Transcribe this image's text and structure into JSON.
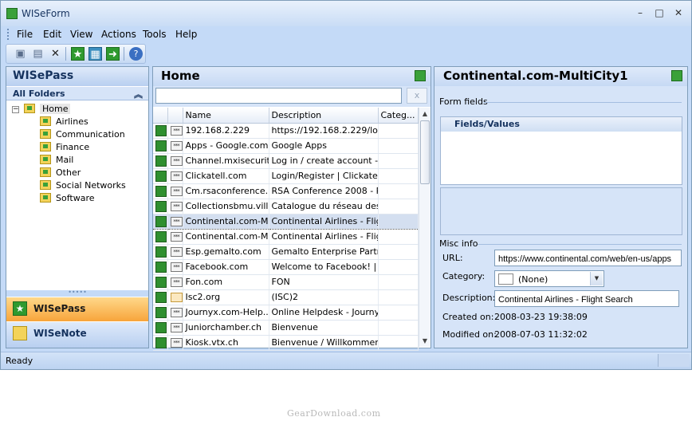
{
  "app": {
    "title": "WISeForm"
  },
  "menu": [
    "File",
    "Edit",
    "View",
    "Actions",
    "Tools",
    "Help"
  ],
  "toolbar": [
    {
      "icon": "save-icon",
      "label": "Save"
    },
    {
      "icon": "print-icon",
      "label": "Print"
    },
    {
      "icon": "delete-icon",
      "label": "Delete"
    },
    {
      "icon": "new-item-icon",
      "label": "New"
    },
    {
      "icon": "folder-icon",
      "label": "Folder"
    },
    {
      "icon": "go-icon",
      "label": "Go"
    },
    {
      "icon": "help-icon",
      "label": "Help"
    }
  ],
  "left": {
    "title": "WISePass",
    "section": "All Folders",
    "root": "Home",
    "folders": [
      "Airlines",
      "Communication",
      "Finance",
      "Mail",
      "Other",
      "Social Networks",
      "Software"
    ],
    "tabs": [
      {
        "label": "WISePass",
        "active": true
      },
      {
        "label": "WISeNote",
        "active": false
      }
    ]
  },
  "middle": {
    "title": "Home",
    "search": {
      "value": "",
      "clear_label": "x"
    },
    "columns": [
      "Name",
      "Description",
      "Categ..."
    ],
    "rows": [
      {
        "name": "192.168.2.229",
        "description": "https://192.168.2.229/lo...",
        "category": "",
        "cert": false,
        "selected": false
      },
      {
        "name": "Apps - Google.com",
        "description": "Google Apps",
        "category": "",
        "cert": false,
        "selected": false
      },
      {
        "name": "Channel.mxisecurit...",
        "description": "Log in / create account - ...",
        "category": "",
        "cert": false,
        "selected": false
      },
      {
        "name": "Clickatell.com",
        "description": "Login/Register | Clickatell",
        "category": "",
        "cert": false,
        "selected": false
      },
      {
        "name": "Cm.rsaconference....",
        "description": "RSA Conference 2008 - P...",
        "category": "",
        "cert": false,
        "selected": false
      },
      {
        "name": "Collectionsbmu.vill...",
        "description": "Catalogue du réseau des...",
        "category": "",
        "cert": false,
        "selected": false
      },
      {
        "name": "Continental.com-M...",
        "description": "Continental Airlines - Flig...",
        "category": "",
        "cert": false,
        "selected": true
      },
      {
        "name": "Continental.com-M...",
        "description": "Continental Airlines - Flig...",
        "category": "",
        "cert": false,
        "selected": false
      },
      {
        "name": "Esp.gemalto.com",
        "description": "Gemalto Enterprise Partn...",
        "category": "",
        "cert": false,
        "selected": false
      },
      {
        "name": "Facebook.com",
        "description": "Welcome to Facebook! | ...",
        "category": "",
        "cert": false,
        "selected": false
      },
      {
        "name": "Fon.com",
        "description": "FON",
        "category": "",
        "cert": false,
        "selected": false
      },
      {
        "name": "Isc2.org",
        "description": "(ISC)2",
        "category": "",
        "cert": true,
        "selected": false
      },
      {
        "name": "Journyx.com-Help...",
        "description": "Online Helpdesk - Journy...",
        "category": "",
        "cert": false,
        "selected": false
      },
      {
        "name": "Juniorchamber.ch",
        "description": "Bienvenue",
        "category": "",
        "cert": false,
        "selected": false
      },
      {
        "name": "Kiosk.vtx.ch",
        "description": "Bienvenue / Willkommen",
        "category": "",
        "cert": false,
        "selected": false
      }
    ]
  },
  "right": {
    "title": "Continental.com-MultiCity1",
    "form_fields_label": "Form fields",
    "fields_header": "Fields/Values",
    "misc_label": "Misc info",
    "url_label": "URL:",
    "url_value": "https://www.continental.com/web/en-us/apps",
    "category_label": "Category:",
    "category_value": "(None)",
    "description_label": "Description:",
    "description_value": "Continental Airlines - Flight Search",
    "created_label": "Created on:",
    "created_value": "2008-03-23 19:38:09",
    "modified_label": "Modified on:",
    "modified_value": "2008-07-03 11:32:02"
  },
  "status": {
    "text": "Ready"
  },
  "watermark": "GearDownload.com"
}
